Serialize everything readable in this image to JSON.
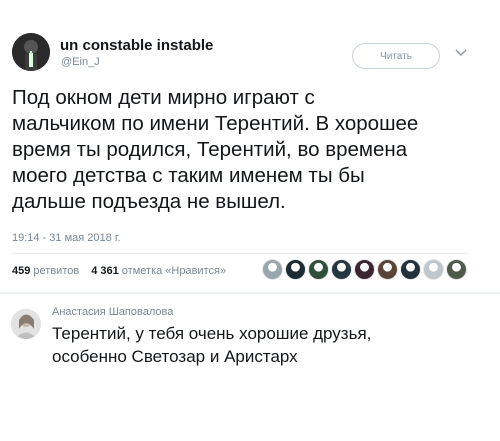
{
  "tweet": {
    "display_name": "un constable instable",
    "handle": "@Ein_J",
    "follow_label": "Читать",
    "text_lines": [
      "Под окном дети мирно играют с",
      "мальчиком по имени Терентий. В хорошее",
      "время ты родился, Терентий, во времена",
      "моего детства с таким именем ты бы",
      "дальше подъезда не вышел."
    ],
    "timestamp": "19:14 - 31 мая 2018 г.",
    "retweets_count": "459",
    "retweets_label": "ретвитов",
    "likes_count": "4 361",
    "likes_label": "отметка «Нравится»",
    "liker_avatars": [
      {
        "icon": "avatar-1",
        "color": "#9aa6ad"
      },
      {
        "icon": "avatar-2",
        "color": "#1d2b34"
      },
      {
        "icon": "avatar-3",
        "color": "#2e4f3c"
      },
      {
        "icon": "avatar-4",
        "color": "#243642"
      },
      {
        "icon": "avatar-5",
        "color": "#3a2530"
      },
      {
        "icon": "avatar-6",
        "color": "#5a4438"
      },
      {
        "icon": "avatar-7",
        "color": "#22313b"
      },
      {
        "icon": "avatar-8",
        "color": "#bfc6cc"
      },
      {
        "icon": "avatar-9",
        "color": "#4f5b4a"
      }
    ]
  },
  "reply": {
    "author": "Анастасия Шаповалова",
    "text_lines": [
      "Терентий, у тебя очень хорошие друзья,",
      "особенно Светозар и Аристарх"
    ]
  },
  "colors": {
    "text": "#14171a",
    "muted": "#7a8793",
    "border": "#e6ecf0"
  }
}
